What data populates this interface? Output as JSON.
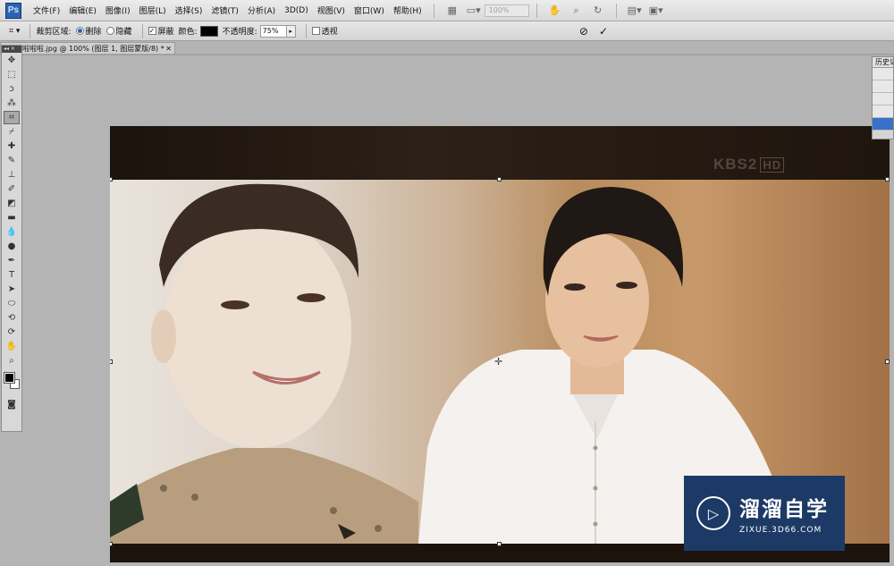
{
  "menubar": {
    "logo": "Ps",
    "items": [
      "文件(F)",
      "编辑(E)",
      "图像(I)",
      "图层(L)",
      "选择(S)",
      "滤镜(T)",
      "分析(A)",
      "3D(D)",
      "视图(V)",
      "窗口(W)",
      "帮助(H)"
    ],
    "zoom_value": "100%"
  },
  "options": {
    "crop_area_label": "裁剪区域:",
    "delete_label": "删除",
    "hide_label": "隐藏",
    "shield_label": "屏蔽",
    "color_label": "颜色:",
    "opacity_label": "不透明度:",
    "opacity_value": "75%",
    "perspective_label": "透视",
    "cancel_symbol": "⊘",
    "commit_symbol": "✓"
  },
  "document": {
    "tab_title": "啦啦啦.jpg @ 100% (图层 1, 图层蒙版/8) *",
    "watermark_text": "KBS2",
    "watermark_badge": "HD"
  },
  "panels": {
    "history_title": "历史记录"
  },
  "watermark": {
    "title": "溜溜自学",
    "url": "ZIXUE.3D66.COM"
  },
  "colors": {
    "foreground": "#000000",
    "background": "#ffffff",
    "watermark_bg": "#1d3a66"
  }
}
